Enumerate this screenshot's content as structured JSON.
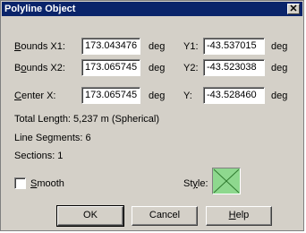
{
  "window": {
    "title": "Polyline Object",
    "close_glyph": "✕"
  },
  "bounds1": {
    "label_pre": "",
    "label_hot": "B",
    "label_post": "ounds X1:",
    "x_value": "173.043476",
    "x_unit": "deg",
    "y_label": "Y1:",
    "y_value": "-43.537015",
    "y_unit": "deg"
  },
  "bounds2": {
    "label_pre": "B",
    "label_hot": "o",
    "label_post": "unds X2:",
    "x_value": "173.065745",
    "x_unit": "deg",
    "y_label": "Y2:",
    "y_value": "-43.523038",
    "y_unit": "deg"
  },
  "center": {
    "label_pre": "",
    "label_hot": "C",
    "label_post": "enter X:",
    "x_value": "173.065745",
    "x_unit": "deg",
    "y_label": "Y:",
    "y_value": "-43.528460",
    "y_unit": "deg"
  },
  "info": {
    "total_length": "Total Length:  5,237 m (Spherical)",
    "line_segments": "Line Segments:  6",
    "sections": "Sections:  1"
  },
  "smooth": {
    "label_pre": "",
    "label_hot": "S",
    "label_post": "mooth",
    "checked": false
  },
  "style": {
    "label_pre": "St",
    "label_hot": "y",
    "label_post": "le:",
    "swatch_fill": "#8ed88e",
    "swatch_line": "#2f7a2f"
  },
  "buttons": {
    "ok": "OK",
    "cancel": "Cancel",
    "help_pre": "",
    "help_hot": "H",
    "help_post": "elp"
  }
}
